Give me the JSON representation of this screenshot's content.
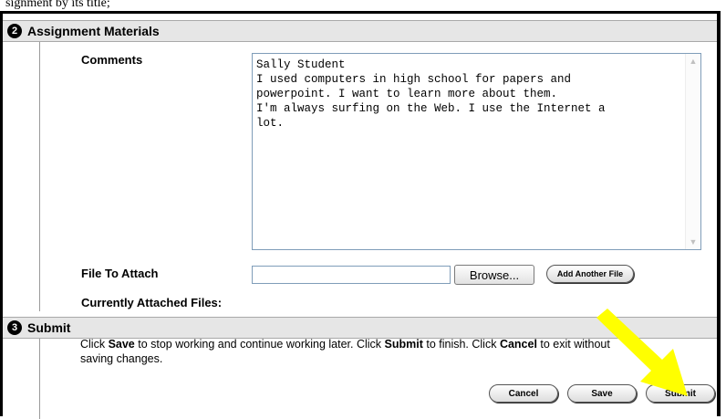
{
  "page": {
    "top_text": "signment by its title;"
  },
  "assignment_materials": {
    "step_number": "2",
    "title": "Assignment Materials",
    "comments_label": "Comments",
    "comments_value": "Sally Student\nI used computers in high school for papers and\npowerpoint. I want to learn more about them.\nI'm always surfing on the Web. I use the Internet a\nlot.",
    "file_attach_label": "File To Attach",
    "file_attach_value": "",
    "browse_label": "Browse...",
    "add_another_file_label": "Add Another File",
    "currently_attached_label": "Currently Attached Files:"
  },
  "submit_section": {
    "step_number": "3",
    "title": "Submit",
    "instr_part1": "Click ",
    "instr_save": "Save",
    "instr_part2": " to stop working and continue working later. Click ",
    "instr_submit": "Submit",
    "instr_part3": " to finish. Click ",
    "instr_cancel": "Cancel",
    "instr_part4": " to exit without",
    "instr_line2": "saving changes.",
    "cancel_label": "Cancel",
    "save_label": "Save",
    "submit_label": "Submit"
  },
  "colors": {
    "section_bar": "#e6e6e6",
    "arrow": "#ffff00"
  }
}
